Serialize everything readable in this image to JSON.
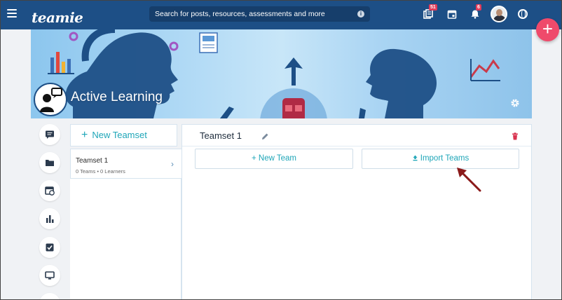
{
  "topbar": {
    "logo_text": "teamie",
    "search_placeholder": "Search for posts, resources, assessments and more",
    "notifications": {
      "resources_count": "51",
      "alerts_count": "6"
    }
  },
  "course": {
    "title": "Active Learning"
  },
  "teamsets": {
    "new_teamset_label": "New Teamset",
    "items": [
      {
        "name": "Teamset 1",
        "teams": "0 Teams",
        "learners": "0 Learners",
        "separator": "•"
      }
    ]
  },
  "panel": {
    "title": "Teamset 1",
    "new_team_label": "New Team",
    "import_label": "Import Teams"
  },
  "colors": {
    "topbar": "#1d4f86",
    "accent": "#1fa6b8",
    "fab": "#ef4a6b",
    "badge": "#e23b5a",
    "delete": "#d9334f",
    "annotation_arrow": "#8b1a1a"
  },
  "icons": {
    "menu": "hamburger-menu-icon",
    "search_info": "info-icon",
    "resources": "library-icon",
    "calendar": "calendar-icon",
    "alerts": "bell-icon",
    "language": "globe-icon",
    "add": "plus-icon",
    "settings": "gear-icon",
    "rail": [
      "chat-icon",
      "folder-icon",
      "calendar-clock-icon",
      "bar-chart-icon",
      "checkbox-icon",
      "monitor-icon"
    ],
    "edit": "pencil-icon",
    "delete": "trash-icon",
    "upload": "upload-icon",
    "chevron": "chevron-right-icon"
  }
}
